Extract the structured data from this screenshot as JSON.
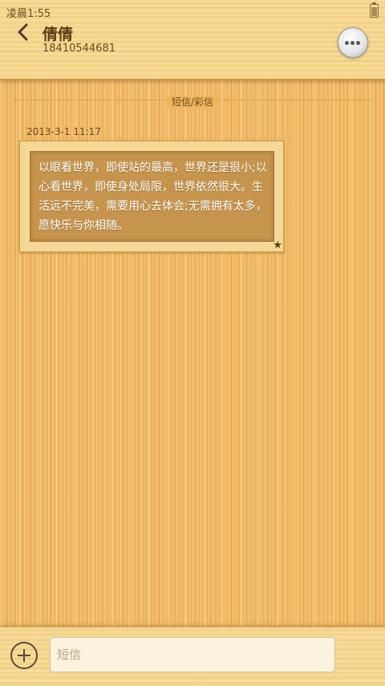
{
  "status_bar": {
    "time": "凌晨1:55",
    "battery_icon": "battery-icon"
  },
  "header": {
    "back_icon": "chevron-left-icon",
    "contact_name": "倩倩",
    "contact_number": "18410544681",
    "more_icon": "more-dots-icon"
  },
  "conversation": {
    "type_label": "短信/彩信",
    "messages": [
      {
        "timestamp": "2013-3-1 11:17",
        "text": "以眼看世界，即使站的最高，世界还是很小;以心看世界，即使身处局限，世界依然很大。生活远不完美，需要用心去体会;无需拥有太多，愿快乐与你相随。",
        "star_icon": "star-icon"
      }
    ]
  },
  "input_bar": {
    "add_icon": "add-circle-icon",
    "placeholder": "短信"
  },
  "colors": {
    "wood": "#efb55e",
    "text_dark": "#5b3b12",
    "bubble": "#c6944c"
  }
}
